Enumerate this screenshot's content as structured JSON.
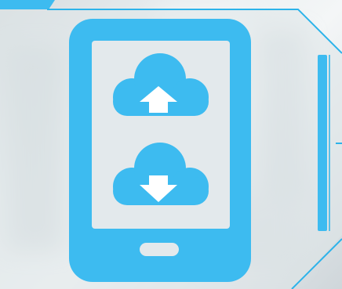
{
  "colors": {
    "accent": "#3dbbf0",
    "frame_line": "#2cb3ea",
    "panel_fill": "#dde3e6",
    "background": "#e6ebee"
  },
  "icons": {
    "device": "tablet-phone-icon",
    "upload": "cloud-upload-icon",
    "download": "cloud-download-icon"
  }
}
